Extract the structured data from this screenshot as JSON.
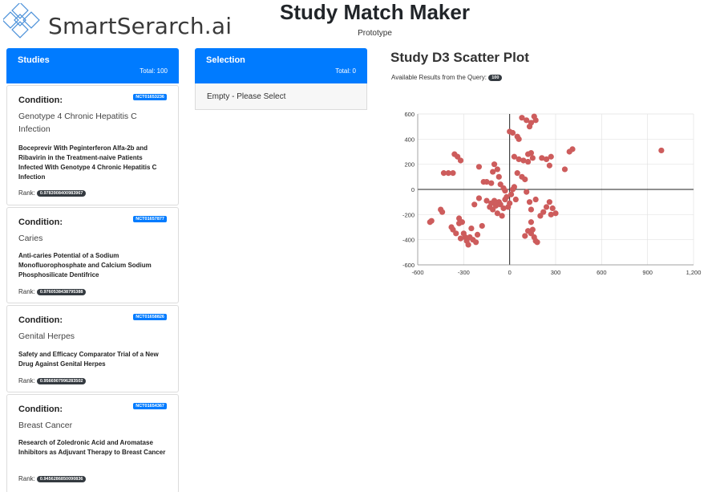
{
  "header": {
    "logo_text": "SmartSerarch.ai",
    "title": "Study Match Maker",
    "subtitle": "Prototype"
  },
  "studies": {
    "heading": "Studies",
    "total": "Total: 100",
    "cards": [
      {
        "condition_label": "Condition:",
        "nct": "NCT01653236",
        "condition": "Genotype 4 Chronic Hepatitis C Infection",
        "title": "Boceprevir With Peginterferon Alfa-2b and Ribavirin in the Treatment-naive Patients Infected With Genotype 4 Chronic Hepatitis C Infection",
        "rank_label": "Rank:",
        "rank": "0.9783908400983967"
      },
      {
        "condition_label": "Condition:",
        "nct": "NCT01657877",
        "condition": "Caries",
        "title": "Anti-caries Potential of a Sodium Monofluorophosphate and Calcium Sodium Phosphosilicate Dentifrice",
        "rank_label": "Rank:",
        "rank": "0.9760538438795388"
      },
      {
        "condition_label": "Condition:",
        "nct": "NCT01658826",
        "condition": "Genital Herpes",
        "title": "Safety and Efficacy Comparator Trial of a New Drug Against Genital Herpes",
        "rank_label": "Rank:",
        "rank": "0.9566907996283502"
      },
      {
        "condition_label": "Condition:",
        "nct": "NCT01654367",
        "condition": "Breast Cancer",
        "title": "Research of Zoledronic Acid and Aromatase Inhibitors as Adjuvant Therapy to Breast Cancer",
        "rank_label": "Rank:",
        "rank": "0.9456286850090836"
      }
    ]
  },
  "selection": {
    "heading": "Selection",
    "total": "Total: 0",
    "empty_text": "Empty - Please Select"
  },
  "plot": {
    "title": "Study D3 Scatter Plot",
    "results_label": "Available Results from the Query:",
    "results_count": "100"
  },
  "colors": {
    "primary": "#007bff",
    "badge_dark": "#343a40",
    "point": "#cd5c5c"
  },
  "chart_data": {
    "type": "scatter",
    "title": "",
    "xlabel": "",
    "ylabel": "",
    "xlim": [
      -600,
      1200
    ],
    "ylim": [
      -600,
      600
    ],
    "x_ticks": [
      "-600",
      "-300",
      "0",
      "300",
      "600",
      "900",
      "1,200"
    ],
    "y_ticks": [
      "600",
      "400",
      "200",
      "0",
      "-200",
      "-400",
      "-600"
    ],
    "grid": true,
    "points": [
      [
        -520,
        -260
      ],
      [
        -510,
        -250
      ],
      [
        -450,
        -160
      ],
      [
        -440,
        -180
      ],
      [
        -380,
        -300
      ],
      [
        -370,
        -320
      ],
      [
        -350,
        -350
      ],
      [
        -330,
        -230
      ],
      [
        -330,
        -270
      ],
      [
        -310,
        -260
      ],
      [
        -320,
        -390
      ],
      [
        -300,
        -350
      ],
      [
        -290,
        -380
      ],
      [
        -280,
        -410
      ],
      [
        -270,
        -440
      ],
      [
        -260,
        -380
      ],
      [
        -250,
        -310
      ],
      [
        -240,
        -400
      ],
      [
        -220,
        -420
      ],
      [
        -210,
        -360
      ],
      [
        -180,
        -290
      ],
      [
        -230,
        -120
      ],
      [
        -200,
        -70
      ],
      [
        -170,
        60
      ],
      [
        -150,
        -90
      ],
      [
        -130,
        -140
      ],
      [
        -120,
        -110
      ],
      [
        -110,
        -160
      ],
      [
        -100,
        -90
      ],
      [
        -90,
        -130
      ],
      [
        -80,
        -190
      ],
      [
        -70,
        -100
      ],
      [
        -60,
        -120
      ],
      [
        -50,
        -210
      ],
      [
        -40,
        -150
      ],
      [
        -30,
        -80
      ],
      [
        -20,
        -60
      ],
      [
        -10,
        -140
      ],
      [
        0,
        -110
      ],
      [
        10,
        -40
      ],
      [
        20,
        0
      ],
      [
        30,
        20
      ],
      [
        40,
        -80
      ],
      [
        -430,
        130
      ],
      [
        -400,
        130
      ],
      [
        -370,
        130
      ],
      [
        -360,
        280
      ],
      [
        -340,
        260
      ],
      [
        -320,
        230
      ],
      [
        -200,
        180
      ],
      [
        -150,
        60
      ],
      [
        -120,
        50
      ],
      [
        -110,
        140
      ],
      [
        -100,
        200
      ],
      [
        -80,
        160
      ],
      [
        -70,
        100
      ],
      [
        -60,
        40
      ],
      [
        -40,
        10
      ],
      [
        -30,
        -10
      ],
      [
        0,
        460
      ],
      [
        20,
        450
      ],
      [
        50,
        420
      ],
      [
        60,
        400
      ],
      [
        80,
        570
      ],
      [
        110,
        550
      ],
      [
        130,
        500
      ],
      [
        140,
        530
      ],
      [
        160,
        580
      ],
      [
        170,
        550
      ],
      [
        30,
        260
      ],
      [
        60,
        240
      ],
      [
        90,
        230
      ],
      [
        120,
        280
      ],
      [
        140,
        290
      ],
      [
        150,
        250
      ],
      [
        120,
        220
      ],
      [
        50,
        130
      ],
      [
        80,
        100
      ],
      [
        100,
        80
      ],
      [
        110,
        -20
      ],
      [
        130,
        -100
      ],
      [
        140,
        -160
      ],
      [
        170,
        -80
      ],
      [
        200,
        -210
      ],
      [
        220,
        -180
      ],
      [
        240,
        -140
      ],
      [
        260,
        -100
      ],
      [
        280,
        -150
      ],
      [
        270,
        -200
      ],
      [
        300,
        -190
      ],
      [
        210,
        250
      ],
      [
        240,
        240
      ],
      [
        260,
        190
      ],
      [
        270,
        260
      ],
      [
        360,
        160
      ],
      [
        390,
        300
      ],
      [
        410,
        320
      ],
      [
        990,
        310
      ],
      [
        100,
        -370
      ],
      [
        120,
        -330
      ],
      [
        140,
        -350
      ],
      [
        160,
        -380
      ],
      [
        170,
        -410
      ],
      [
        180,
        -420
      ],
      [
        140,
        -260
      ],
      [
        150,
        -320
      ]
    ]
  }
}
